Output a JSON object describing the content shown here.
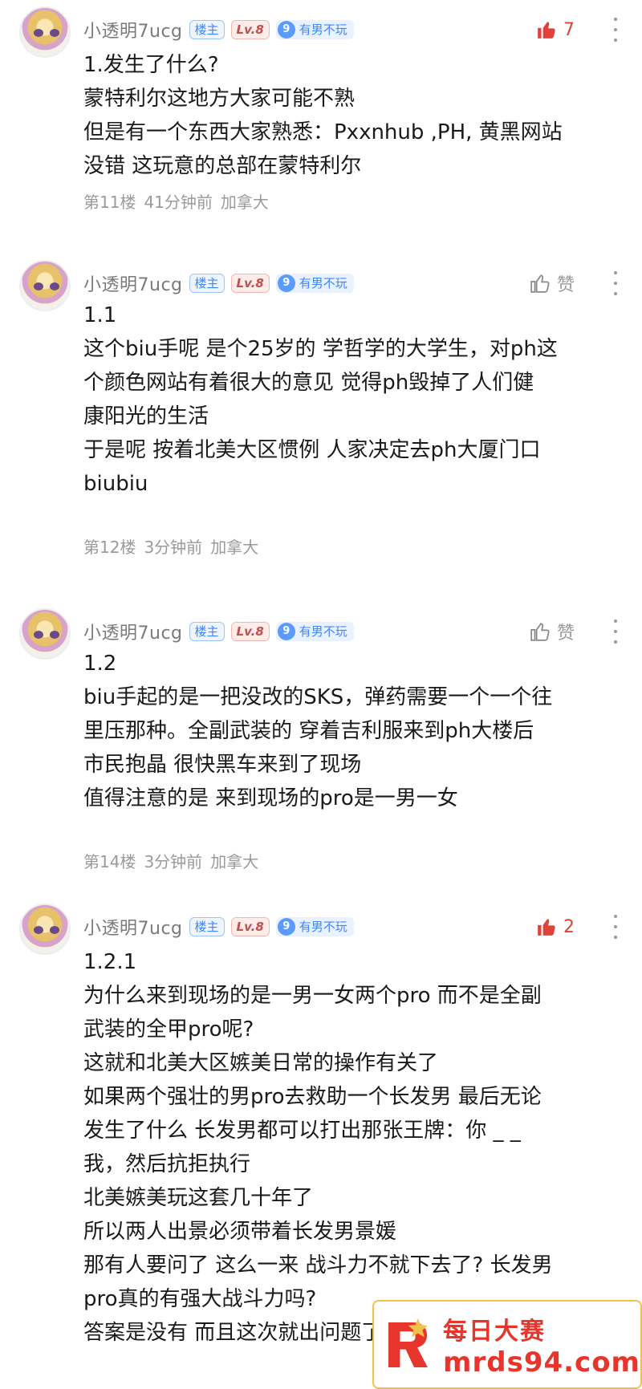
{
  "posts": [
    {
      "username": "小透明7ucg",
      "badge_owner": "楼主",
      "badge_level": "Lv.8",
      "badge_fan_level": "9",
      "badge_fan_text": "有男不玩",
      "like_label": "7",
      "like_active": true,
      "lines": [
        "1.发生了什么?",
        "蒙特利尔这地方大家可能不熟",
        "但是有一个东西大家熟悉：Pxxnhub ,PH, 黄黑网站",
        "没错 这玩意的总部在蒙特利尔"
      ],
      "floor": "第11楼",
      "time": "41分钟前",
      "location": "加拿大"
    },
    {
      "username": "小透明7ucg",
      "badge_owner": "楼主",
      "badge_level": "Lv.8",
      "badge_fan_level": "9",
      "badge_fan_text": "有男不玩",
      "like_label": "赞",
      "like_active": false,
      "lines": [
        "1.1",
        "这个biu手呢 是个25岁的 学哲学的大学生，对ph这",
        "个颜色网站有着很大的意见 觉得ph毁掉了人们健",
        "康阳光的生活",
        "于是呢 按着北美大区惯例 人家决定去ph大厦门口",
        "biubiu"
      ],
      "floor": "第12楼",
      "time": "3分钟前",
      "location": "加拿大"
    },
    {
      "username": "小透明7ucg",
      "badge_owner": "楼主",
      "badge_level": "Lv.8",
      "badge_fan_level": "9",
      "badge_fan_text": "有男不玩",
      "like_label": "赞",
      "like_active": false,
      "lines": [
        "1.2",
        "biu手起的是一把没改的SKS，弹药需要一个一个往",
        "里压那种。全副武装的 穿着吉利服来到ph大楼后",
        "市民抱晶 很快黑车来到了现场",
        "值得注意的是 来到现场的pro是一男一女"
      ],
      "floor": "第14楼",
      "time": "3分钟前",
      "location": "加拿大"
    },
    {
      "username": "小透明7ucg",
      "badge_owner": "楼主",
      "badge_level": "Lv.8",
      "badge_fan_level": "9",
      "badge_fan_text": "有男不玩",
      "like_label": "2",
      "like_active": true,
      "lines": [
        "1.2.1",
        "为什么来到现场的是一男一女两个pro 而不是全副",
        "武装的全甲pro呢?",
        "这就和北美大区嫉美日常的操作有关了",
        "如果两个强壮的男pro去救助一个长发男 最后无论",
        "发生了什么 长发男都可以打出那张王牌：你 _ _",
        "我，然后抗拒执行",
        "北美嫉美玩这套几十年了",
        "所以两人出景必须带着长发男景媛",
        "那有人要问了 这么一来 战斗力不就下去了? 长发男",
        "pro真的有强大战斗力吗?",
        "答案是没有 而且这次就出问题了"
      ],
      "floor": "",
      "time": "",
      "location": ""
    }
  ],
  "watermark": {
    "title": "每日大赛",
    "url": "mrds94.com"
  },
  "colors": {
    "like_active": "#e0413a",
    "owner_badge": "#3d86ff",
    "level_badge": "#c0504d",
    "meta_text": "#9a9a9a"
  }
}
